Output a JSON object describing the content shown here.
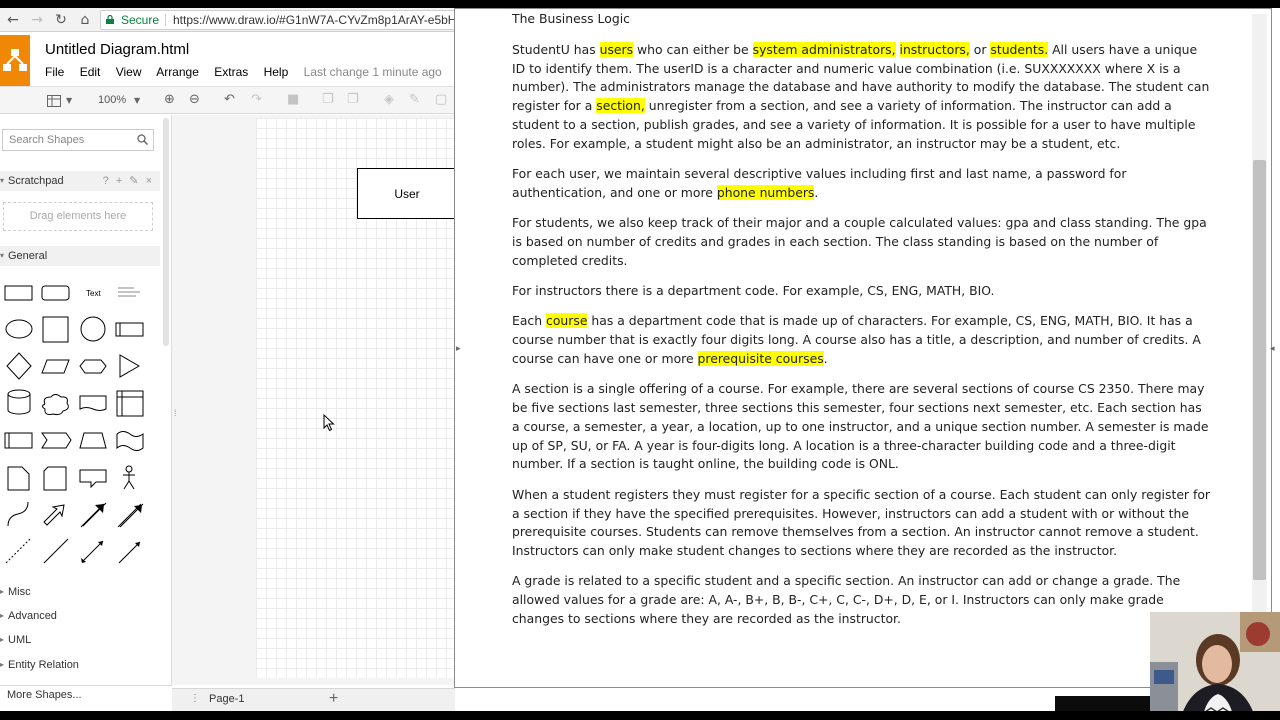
{
  "browser": {
    "secure_label": "Secure",
    "url": "https://www.draw.io/#G1nW7A-CYvZm8p1ArAY-e5bH"
  },
  "app": {
    "title": "Untitled Diagram.html",
    "menu": [
      "File",
      "Edit",
      "View",
      "Arrange",
      "Extras",
      "Help"
    ],
    "last_change": "Last change 1 minute ago",
    "zoom": "100%"
  },
  "sidebar": {
    "search_placeholder": "Search Shapes",
    "scratchpad": "Scratchpad",
    "scratch_tools": "? + ✎ ×",
    "dropzone": "Drag elements here",
    "general": "General",
    "text_shape": "Text",
    "sections": [
      "Misc",
      "Advanced",
      "UML",
      "Entity Relation"
    ],
    "more_shapes": "More Shapes..."
  },
  "canvas": {
    "user_box": "User",
    "page_tab": "Page-1",
    "add_page": "+"
  },
  "doc": {
    "heading": "The Business Logic",
    "p1": [
      "StudentU has ",
      "users",
      " who can either be ",
      "system administrators,",
      " ",
      "instructors,",
      " or ",
      "students.",
      " All users have a unique ID to identify them. The userID is a character and numeric value combination (i.e. SUXXXXXXX where X is a number). The administrators manage the database and have authority to modify the database. The student can register for a ",
      "section,",
      " unregister from a section, and see a variety of information. The instructor can add a student to a section, publish grades, and see a variety of information. It is possible for a user to have multiple roles. For example, a student might also be an administrator, an instructor may be a student, etc."
    ],
    "p2": [
      "For each user, we maintain several descriptive values including first and last name, a password for authentication, and one or more ",
      "phone numbers",
      "."
    ],
    "p3": "For students, we also keep track of their major and a couple calculated values: gpa and class standing. The gpa is based on number of credits and grades in each section. The class standing is based on the number of completed credits.",
    "p4": "For instructors there is a department code. For example, CS, ENG, MATH, BIO.",
    "p5": [
      "Each ",
      "course",
      " has a department code that is made up of characters. For example, CS, ENG, MATH, BIO. It has a course number that is exactly four digits long. A course also has a title, a description, and number of credits. A course can have one or more ",
      "prerequisite courses",
      "."
    ],
    "p6": "A section is a single offering of a course. For example, there are several sections of course CS 2350. There may be five sections last semester, three sections this semester, four sections next semester, etc. Each section has a course, a semester, a year, a location, up to one instructor, and a unique section number. A semester is made up of SP, SU, or FA. A year is four-digits long. A location is a three-character building code and a three-digit number. If a section is taught online, the building code is ONL.",
    "p7": "When a student registers they must register for a specific section of a course. Each student can only register for a section if they have the specified prerequisites. However, instructors can add a student with or without the prerequisite courses. Students can remove themselves from a section. An instructor cannot remove a student. Instructors can only make student changes to sections where they are recorded as the instructor.",
    "p8": "A grade is related to a specific student and a specific section. An instructor can add or change a grade. The allowed values for a grade are: A, A-, B+, B, B-, C+, C, C-, D+, D, E, or I. Instructors can only make grade changes to sections where they are recorded as the instructor."
  },
  "colors": {
    "highlight": "#ffff00",
    "drawio_orange": "#f08705"
  }
}
